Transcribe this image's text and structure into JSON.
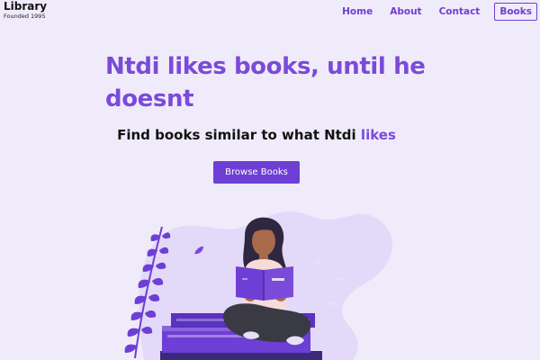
{
  "brand": {
    "title": "Library",
    "subtitle": "Founded 1995"
  },
  "nav": {
    "home": "Home",
    "about": "About",
    "contact": "Contact",
    "books": "Books",
    "active": "books"
  },
  "hero": {
    "title": "Ntdi likes books, until he doesnt",
    "subtitle_main": "Find books similar to what Ntdi",
    "subtitle_accent": "likes",
    "button_label": "Browse Books"
  },
  "colors": {
    "background": "#f0ebfb",
    "accent": "#7a4bd8",
    "button": "#6d3fd4",
    "blob": "#e3d9f8"
  },
  "illustration": {
    "icon": "reading-person-illustration"
  }
}
